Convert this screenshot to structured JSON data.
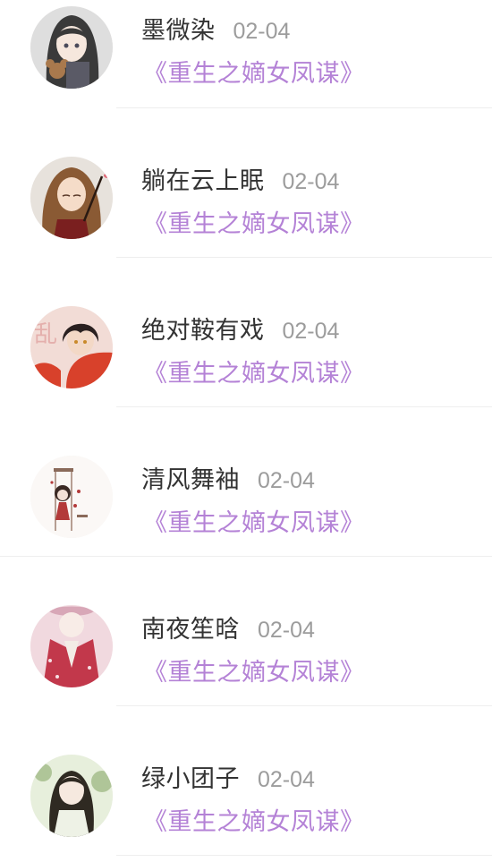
{
  "comments": [
    {
      "username": "墨微染",
      "date": "02-04",
      "book": "《重生之嫡女凤谋》",
      "avatar": {
        "icon": "avatar-girl-with-teddy-bear",
        "bg": "#dedede",
        "hair": "#3a3a3a",
        "skin": "#f6e7dd",
        "accent": "#a9794d"
      }
    },
    {
      "username": "躺在云上眠",
      "date": "02-04",
      "book": "《重生之嫡女凤谋》",
      "avatar": {
        "icon": "avatar-girl-with-wand",
        "bg": "#e7e2dc",
        "hair": "#8a5a34",
        "skin": "#f5dcc8",
        "accent": "#7a1f1f"
      }
    },
    {
      "username": "绝对鞍有戏",
      "date": "02-04",
      "book": "《重生之嫡女凤谋》",
      "avatar": {
        "icon": "avatar-boy-red-robe",
        "bg": "#f2dcd6",
        "hair": "#2a2020",
        "skin": "#f3d8c6",
        "accent": "#d8412b"
      }
    },
    {
      "username": "清风舞袖",
      "date": "02-04",
      "book": "《重生之嫡女凤谋》",
      "avatar": {
        "icon": "avatar-chibi-scene",
        "bg": "#fbf8f6",
        "hair": "#3b2a25",
        "skin": "#f3e0d6",
        "accent": "#b33a3a"
      }
    },
    {
      "username": "南夜笙晗",
      "date": "02-04",
      "book": "《重生之嫡女凤谋》",
      "avatar": {
        "icon": "avatar-girl-red-hanfu",
        "bg": "#f1d9df",
        "hair": "#d8a7b7",
        "skin": "#f8ece7",
        "accent": "#c2384b"
      }
    },
    {
      "username": "绿小团子",
      "date": "02-04",
      "book": "《重生之嫡女凤谋》",
      "avatar": {
        "icon": "avatar-girl-green-garden",
        "bg": "#e7efdc",
        "hair": "#2f2a22",
        "skin": "#f6e9df",
        "accent": "#8aa86a"
      }
    }
  ]
}
